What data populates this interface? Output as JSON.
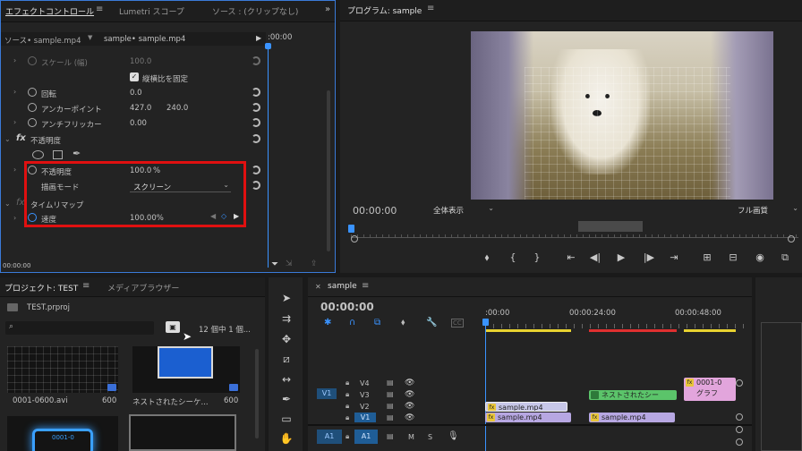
{
  "effect_panel": {
    "tabs": [
      "エフェクトコントロール",
      "Lumetri スコープ",
      "ソース : (クリップなし)"
    ],
    "source_label": "ソース• sample.mp4",
    "clip_label": "sample• sample.mp4",
    "timecode_ruler": ":00:00",
    "rows": {
      "scale_w": "スケール (幅)",
      "scale_w_val": "100.0",
      "keep_ratio": "縦横比を固定",
      "rotation": "回転",
      "rotation_val": "0.0",
      "anchor": "アンカーポイント",
      "anchor_x": "427.0",
      "anchor_y": "240.0",
      "flicker": "アンチフリッカー",
      "flicker_val": "0.00",
      "opacity_group": "不透明度",
      "opacity": "不透明度",
      "opacity_val": "100.0",
      "opacity_unit": "%",
      "blend": "描画モード",
      "blend_val": "スクリーン",
      "time_remap": "タイムリマップ",
      "speed": "速度",
      "speed_val": "100.00%"
    },
    "footer_timecode": "00:00:00"
  },
  "program_panel": {
    "title": "プログラム: sample",
    "timecode": "00:00:00",
    "zoom": "全体表示",
    "quality": "フル画質"
  },
  "project_panel": {
    "tabs": [
      "プロジェクト: TEST",
      "メディアブラウザー"
    ],
    "file": "TEST.prproj",
    "count": "12 個中 1 個...",
    "items": [
      {
        "name": "0001-0600.avi",
        "dur": "600"
      },
      {
        "name": "ネストされたシーケ...",
        "dur": "600"
      }
    ],
    "thumb_text": "0001-0"
  },
  "timeline": {
    "tab": "sample",
    "timecode": "00:00:00",
    "ruler": [
      ":00:00",
      "00:00:24:00",
      "00:00:48:00"
    ],
    "tracks": [
      "V4",
      "V3",
      "V2",
      "V1",
      "A1"
    ],
    "src_v1": "V1",
    "src_a1": "A1",
    "clips": {
      "v2a": "sample.mp4",
      "v1a": "sample.mp4",
      "v1b": "sample.mp4",
      "v3": "ネストされたシー",
      "v4": "0001-0",
      "v3b": "グラフ"
    },
    "m": "M",
    "s": "S"
  }
}
